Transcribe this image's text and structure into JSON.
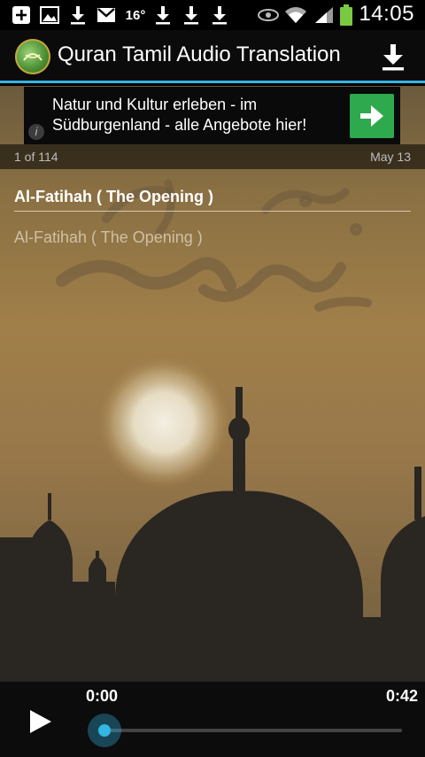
{
  "status_bar": {
    "time": "14:05",
    "temperature": "16°",
    "icons": [
      "add-box-icon",
      "image-icon",
      "download-icon",
      "gmail-icon",
      "weather-icon",
      "download-icon",
      "download-icon",
      "download-icon",
      "eye-icon",
      "wifi-icon",
      "signal-icon",
      "battery-icon"
    ]
  },
  "action_bar": {
    "title": "Quran Tamil Audio Translation",
    "app_icon": "quran-logo-icon",
    "action_icon": "download-icon",
    "accent_color": "#33b5e5"
  },
  "ad": {
    "text": "Natur und Kultur erleben - im Südburgenland - alle Angebote hier!",
    "info_label": "i",
    "cta_icon": "arrow-right-icon",
    "cta_color": "#2fa94e"
  },
  "meta": {
    "count": "1 of 114",
    "date": "May 13"
  },
  "surah": {
    "title": "Al-Fatihah ( The Opening )",
    "subtitle": "Al-Fatihah ( The Opening )"
  },
  "player": {
    "current_time": "0:00",
    "total_time": "0:42",
    "progress": 0,
    "play_icon": "play-icon"
  }
}
